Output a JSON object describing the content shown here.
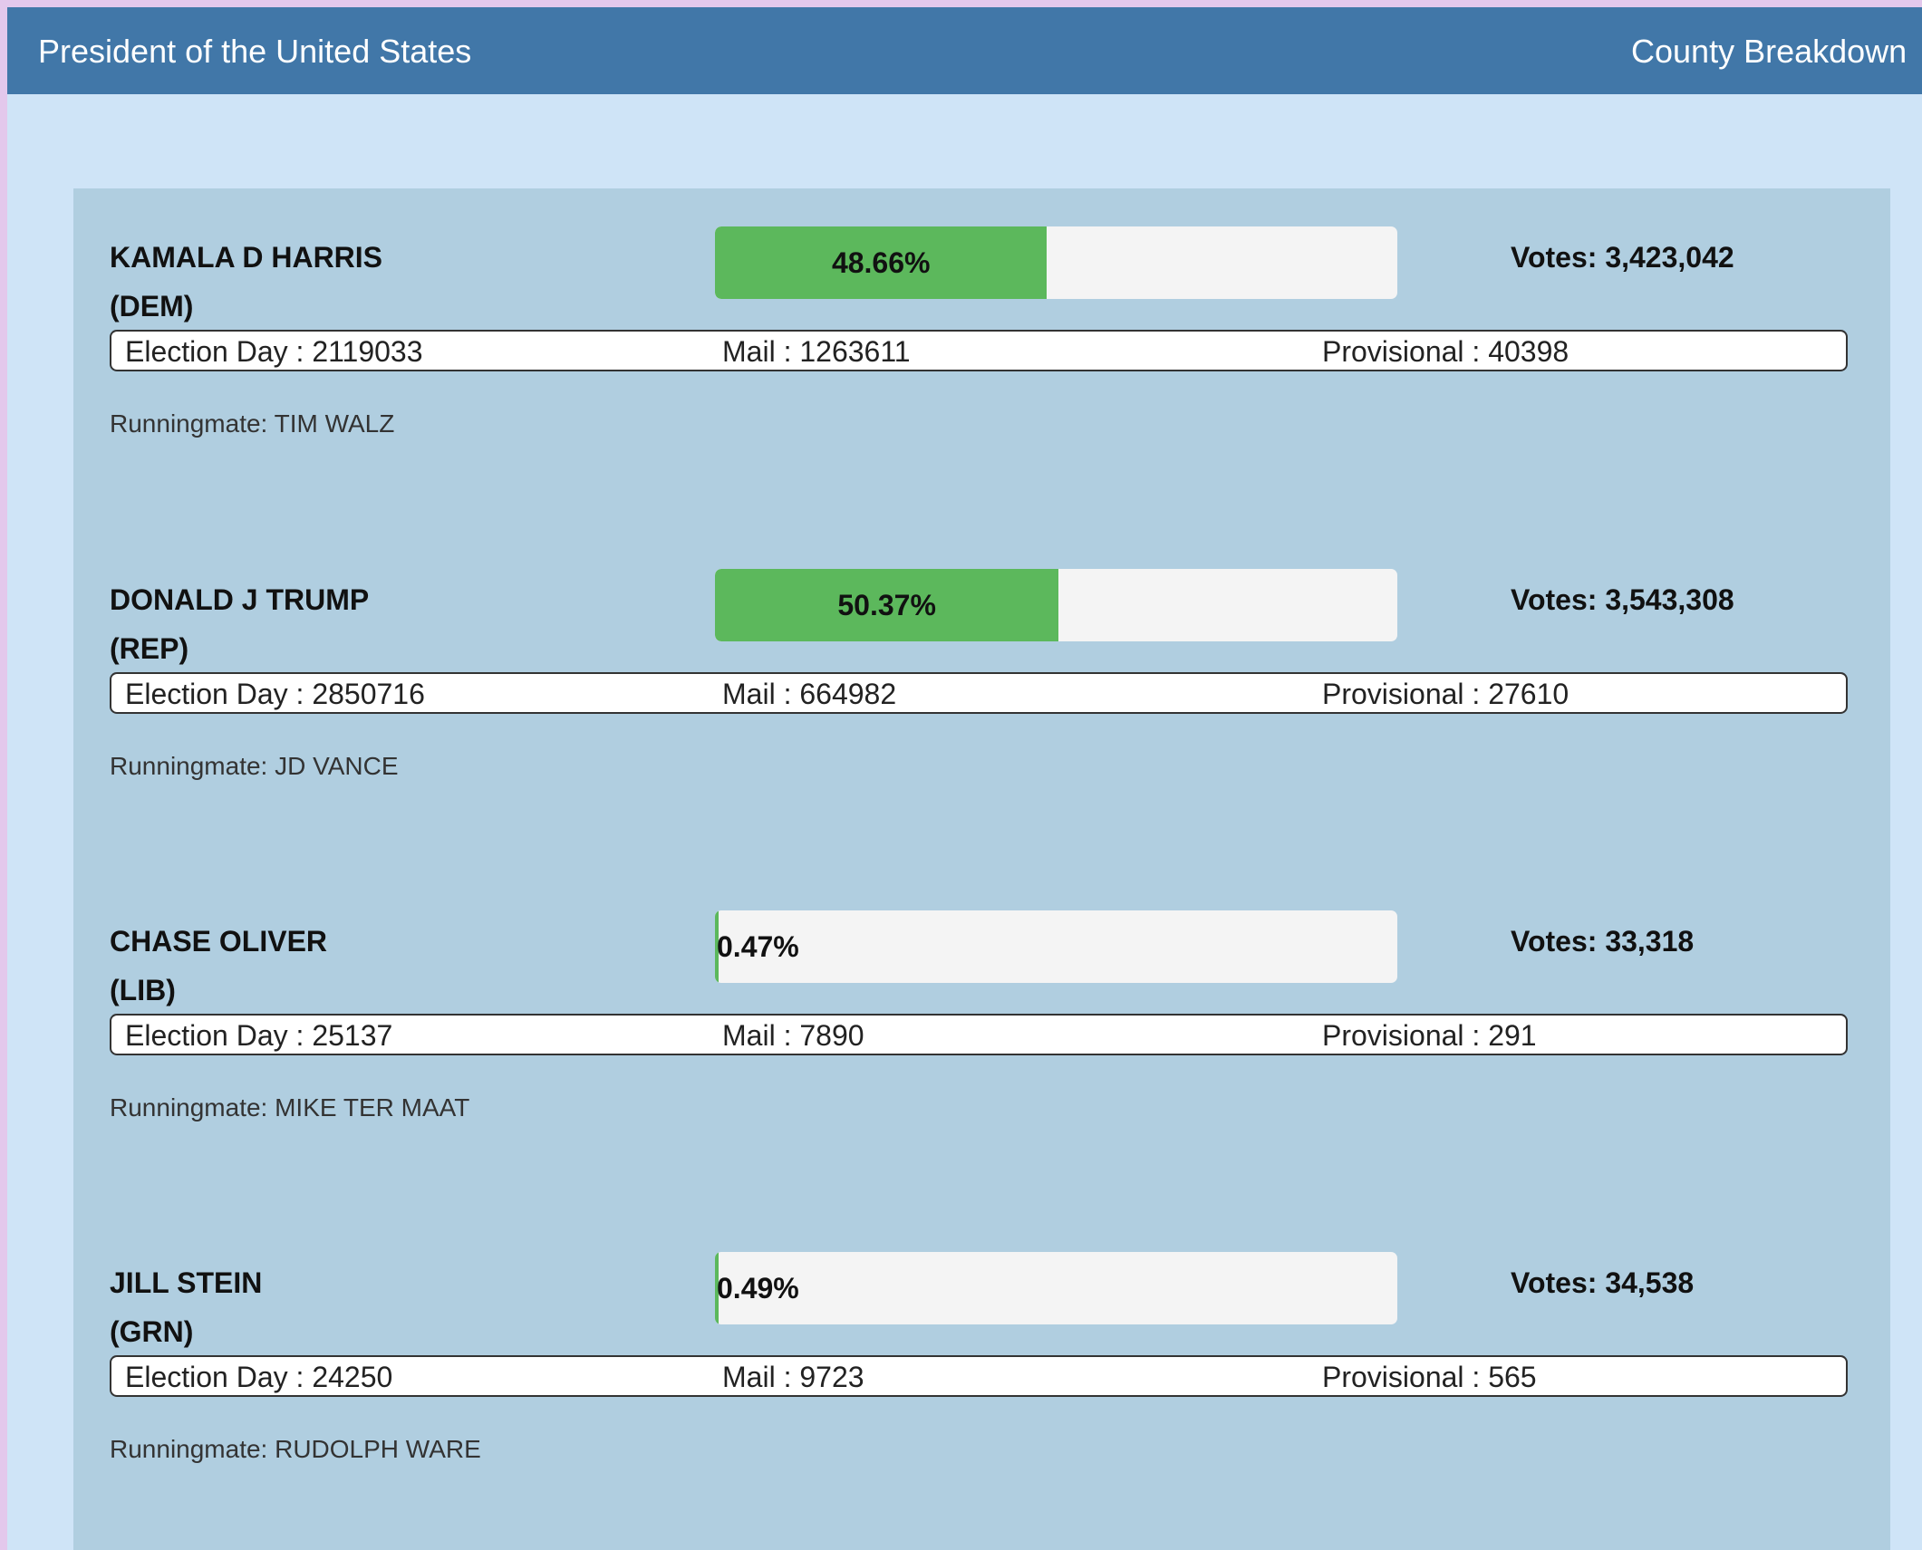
{
  "header": {
    "title": "President of the United States",
    "link_label": "County Breakdown"
  },
  "candidates": [
    {
      "name": "KAMALA D HARRIS",
      "party": "(DEM)",
      "percent_label": "48.66%",
      "percent_value": 48.66,
      "votes_label": "Votes: 3,423,042",
      "election_day": "Election Day : 2119033",
      "mail": "Mail : 1263611",
      "provisional": "Provisional : 40398",
      "runningmate": "Runningmate: TIM WALZ"
    },
    {
      "name": "DONALD J TRUMP",
      "party": "(REP)",
      "percent_label": "50.37%",
      "percent_value": 50.37,
      "votes_label": "Votes: 3,543,308",
      "election_day": "Election Day : 2850716",
      "mail": "Mail : 664982",
      "provisional": "Provisional : 27610",
      "runningmate": "Runningmate: JD VANCE"
    },
    {
      "name": "CHASE OLIVER",
      "party": "(LIB)",
      "percent_label": "0.47%",
      "percent_value": 0.47,
      "votes_label": "Votes: 33,318",
      "election_day": "Election Day : 25137",
      "mail": "Mail : 7890",
      "provisional": "Provisional : 291",
      "runningmate": "Runningmate: MIKE TER MAAT"
    },
    {
      "name": "JILL STEIN",
      "party": "(GRN)",
      "percent_label": "0.49%",
      "percent_value": 0.49,
      "votes_label": "Votes: 34,538",
      "election_day": "Election Day : 24250",
      "mail": "Mail : 9723",
      "provisional": "Provisional : 565",
      "runningmate": "Runningmate: RUDOLPH WARE"
    }
  ],
  "colors": {
    "header_bg": "#4177a8",
    "page_bg": "#cfe4f7",
    "panel_bg": "#b0cee0",
    "bar_fill": "#5cb85c",
    "bar_track": "#f4f4f4"
  }
}
